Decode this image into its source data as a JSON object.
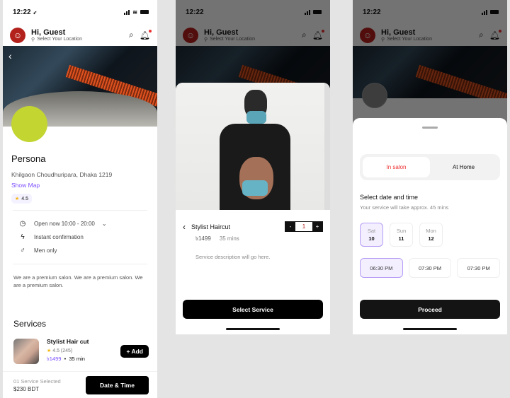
{
  "status_bar": {
    "time": "12:22",
    "arrow": "➶"
  },
  "header": {
    "greeting": "Hi, Guest",
    "location": "Select Your Location"
  },
  "salon": {
    "name": "Persona",
    "address": "Khilgaon Choudhuripara, Dhaka 1219",
    "show_map": "Show Map",
    "rating": "4.5",
    "features": [
      {
        "icon": "clock-icon",
        "glyph": "◷",
        "label": "Open now 10:00 - 20:00",
        "chevron": "⌄"
      },
      {
        "icon": "bolt-icon",
        "glyph": "ϟ",
        "label": "Instant confirmation"
      },
      {
        "icon": "male-icon",
        "glyph": "♂",
        "label": "Men only"
      }
    ],
    "about": "We are a premium salon. We are a premium salon.  We are a premium salon.",
    "accent": "#7c4dff",
    "logo_color": "#c2d531"
  },
  "services": {
    "heading": "Services",
    "items": [
      {
        "title": "Stylist Hair cut",
        "rating": "4.5",
        "reviews": "(245)",
        "price": "৳1499",
        "duration": "35 min",
        "add_label": "+ Add"
      }
    ]
  },
  "footer": {
    "count": "01 Service Selected",
    "price": "$230 BDT",
    "button": "Date & Time"
  },
  "service_detail": {
    "title": "Stylist Haircut",
    "price": "৳1499",
    "duration": "35 mins",
    "description": "Service description will go here.",
    "qty_minus": "-",
    "qty_value": "1",
    "qty_plus": "+",
    "button": "Select Service"
  },
  "booking": {
    "tabs": [
      {
        "label": "In salon",
        "active": true
      },
      {
        "label": "At Home",
        "active": false
      }
    ],
    "title": "Select date and time",
    "subtitle": "Your service will take approx. 45 mins",
    "days": [
      {
        "name": "Sat",
        "date": "10",
        "selected": true
      },
      {
        "name": "Sun",
        "date": "11",
        "selected": false
      },
      {
        "name": "Mon",
        "date": "12",
        "selected": false
      }
    ],
    "times": [
      {
        "label": "06:30 PM",
        "selected": true
      },
      {
        "label": "07:30 PM",
        "selected": false
      },
      {
        "label": "07:30 PM",
        "selected": false
      }
    ],
    "button": "Proceed"
  }
}
